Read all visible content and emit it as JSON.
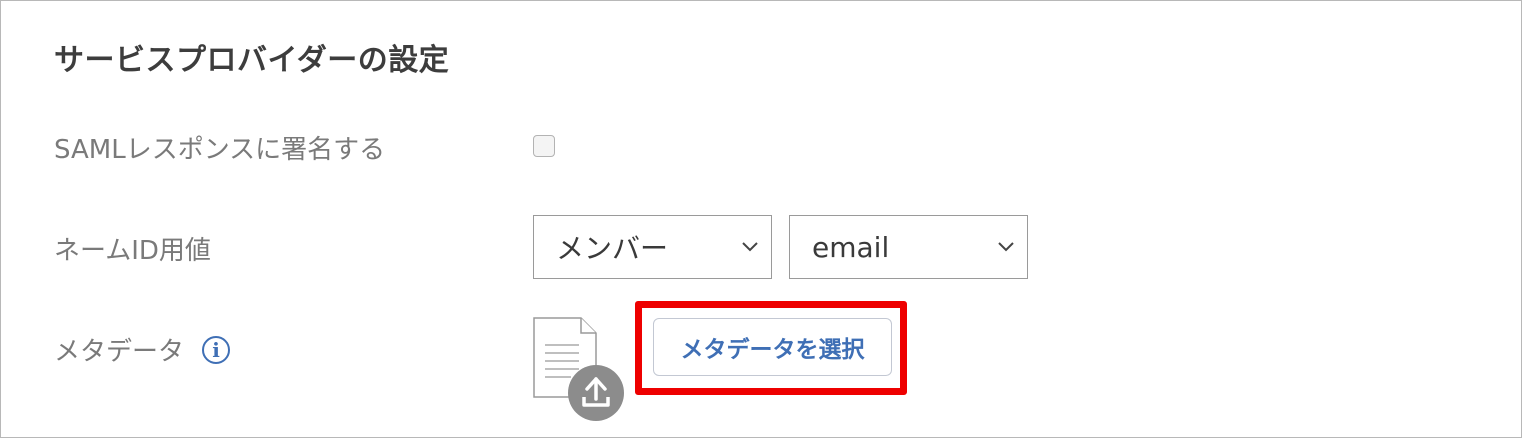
{
  "section": {
    "title": "サービスプロバイダーの設定"
  },
  "saml_sign": {
    "label": "SAMLレスポンスに署名する",
    "checked": false
  },
  "name_id": {
    "label": "ネームID用値",
    "type_select": {
      "value": "メンバー"
    },
    "attribute_select": {
      "value": "email"
    }
  },
  "metadata": {
    "label": "メタデータ",
    "info_icon_glyph": "i",
    "select_button_label": "メタデータを選択",
    "highlight_color": "#ee0000",
    "accent_color": "#3f6fb5"
  },
  "icons": {
    "info": "info-icon",
    "file": "document-icon",
    "upload": "upload-icon",
    "dropdown": "chevron-down-icon"
  }
}
